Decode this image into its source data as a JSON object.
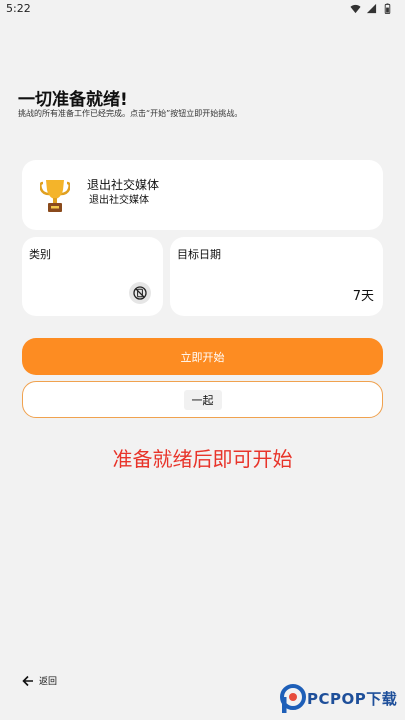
{
  "status_bar": {
    "time": "5:22",
    "icons": [
      "wifi-icon",
      "signal-icon",
      "battery-icon"
    ]
  },
  "header": {
    "title": "一切准备就绪!",
    "subtitle": "挑战的所有准备工作已经完成。点击“开始”按钮立即开始挑战。"
  },
  "goal": {
    "icon": "trophy-icon",
    "title": "退出社交媒体",
    "subtitle": "退出社交媒体"
  },
  "category": {
    "label": "类别",
    "icon": "no-phone-icon"
  },
  "target": {
    "label": "目标日期",
    "value": "7天"
  },
  "actions": {
    "start_label": "立即开始",
    "together_label": "一起"
  },
  "notice": "准备就绪后即可开始",
  "footer": {
    "back_label": "返回"
  },
  "watermark": {
    "brand": "PCPOP下载"
  },
  "colors": {
    "accent": "#fd8c22",
    "notice": "#e8342a",
    "background": "#f2f2f2"
  }
}
